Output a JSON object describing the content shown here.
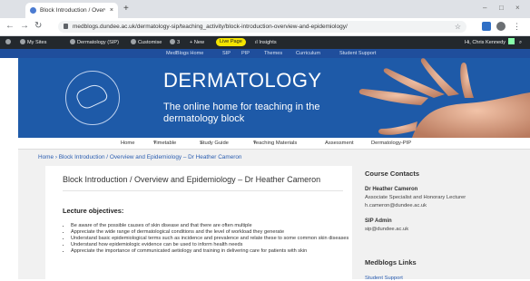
{
  "browser": {
    "tab_title": "Block Introduction / Overview a",
    "tab_close": "×",
    "new_tab": "+",
    "window_controls": [
      "–",
      "□",
      "×"
    ],
    "url": "medblogs.dundee.ac.uk/dermatology-sip/teaching_activity/block-introduction-overview-and-epidemiology/",
    "bookmark_icon": "star-icon"
  },
  "wp_admin": {
    "items": [
      "My Sites",
      "Dermatology (SIP)",
      "Customise",
      "3",
      "New",
      "Live Page",
      "Insights"
    ],
    "greeting": "Hi, Chris Kennedy",
    "live_color": "#f4e400"
  },
  "top_links": [
    "MedBlogs Home",
    "SIP",
    "PIP",
    "Themes",
    "Curriculum",
    "Student Support"
  ],
  "banner": {
    "title": "DERMATOLOGY",
    "subtitle": "The online home for teaching in the dermatology block",
    "brand_color": "#1e5aa8"
  },
  "site_nav": [
    "Home",
    "Timetable",
    "Study Guide",
    "Teaching Materials",
    "Assessment",
    "Dermatology-PIP"
  ],
  "breadcrumb": "Home › Block Introduction / Overview and Epidemiology – Dr Heather Cameron",
  "article": {
    "title": "Block Introduction / Overview and Epidemiology – Dr Heather Cameron",
    "objectives_heading": "Lecture objectives:",
    "objectives": [
      "Be aware of the possible causes of skin disease and that there are often multiple",
      "Appreciate the wide range of dermatological conditions and the level of workload they generate",
      "Understand basic epidemiological terms such as incidence and prevalence and relate these to some common skin diseases",
      "Understand how epidemiologic evidence can be used to inform health needs",
      "Appreciate the importance of communicated aetiology and training in delivering care for patients with skin"
    ]
  },
  "sidebar": {
    "contacts_heading": "Course Contacts",
    "contact1_name": "Dr Heather Cameron",
    "contact1_role": "Associate Specialist and Honorary Lecturer",
    "contact1_email": "h.cameron@dundee.ac.uk",
    "contact2_name": "SIP Admin",
    "contact2_email": "sip@dundee.ac.uk",
    "links_heading": "Medblogs Links",
    "link1": "Student Support"
  }
}
